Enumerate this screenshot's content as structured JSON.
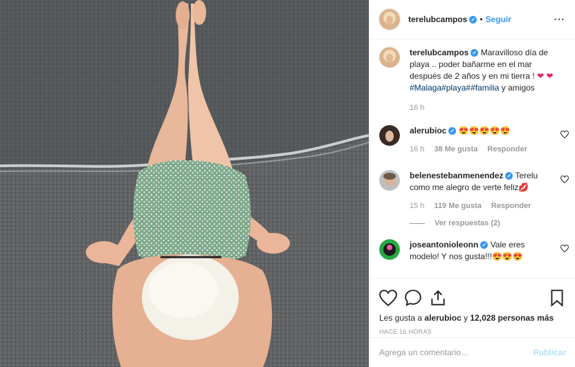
{
  "post": {
    "image_alt": "",
    "header": {
      "username": "terelubcampos",
      "separator": "•",
      "follow_label": "Seguir",
      "more_icon": "ellipsis-icon"
    },
    "caption": {
      "username": "terelubcampos",
      "text": "Maravilloso día de playa .. poder bañarme en el mar después de 2 años y en mi tierra !",
      "tags": [
        "#Malaga",
        "#playa",
        "#",
        "#familia"
      ],
      "tail": " y amigos",
      "time": "16 h"
    },
    "comments": [
      {
        "username": "alerubioc",
        "text": "😍😍😍😍😍",
        "time": "16 h",
        "likes": "38 Me gusta",
        "reply_label": "Responder"
      },
      {
        "username": "belenestebanmenendez",
        "text": "Terelu como me alegro de verte feliz💋",
        "time": "15 h",
        "likes": "119 Me gusta",
        "reply_label": "Responder",
        "view_replies": "Ver respuestas (2)"
      },
      {
        "username": "joseantonioleonn",
        "text": "Vale eres modelo! Y nos gusta!!!😍😍😍"
      }
    ],
    "likes": {
      "prefix": "Les gusta a ",
      "first_user": "alerubioc",
      "middle": " y ",
      "count": "12,028 personas más"
    },
    "timestamp": "HACE 16 HORAS",
    "add_comment": {
      "placeholder": "Agrega un comentario...",
      "publish_label": "Publicar"
    }
  },
  "colors": {
    "link_blue": "#3897f0",
    "hashtag": "#003569",
    "muted": "#999999",
    "publish_disabled": "#b2dffc"
  }
}
